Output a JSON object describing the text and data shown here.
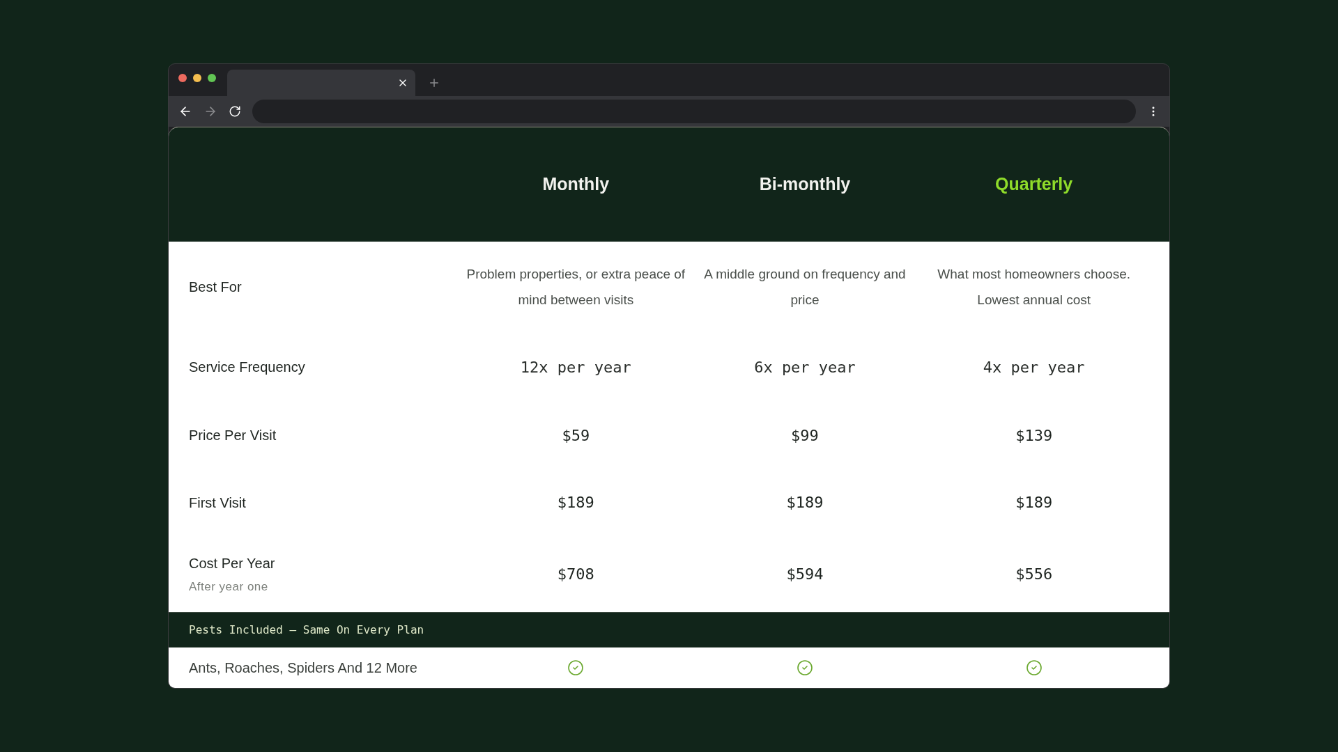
{
  "browser": {
    "forward_disabled": true
  },
  "plans": [
    {
      "name": "Monthly",
      "selected": false
    },
    {
      "name": "Bi-monthly",
      "selected": false
    },
    {
      "name": "Quarterly",
      "selected": true
    }
  ],
  "rows": [
    {
      "label": "Best For",
      "kind": "text",
      "values": [
        "Problem properties, or extra peace of mind between visits",
        "A middle ground on frequency and price",
        "What most homeowners choose. Lowest annual cost"
      ]
    },
    {
      "label": "Service Frequency",
      "kind": "mono",
      "values": [
        "12x per year",
        "6x per year",
        "4x per year"
      ]
    },
    {
      "label": "Price Per Visit",
      "kind": "price",
      "values": [
        "$59",
        "$99",
        "$139"
      ]
    },
    {
      "label": "First Visit",
      "kind": "price",
      "values": [
        "$189",
        "$189",
        "$189"
      ]
    },
    {
      "label": "Cost Per Year",
      "sublabel": "After year one",
      "kind": "price",
      "values": [
        "$708",
        "$594",
        "$556"
      ]
    }
  ],
  "section": {
    "title": "Pests Included — Same On Every Plan"
  },
  "pest_rows": [
    {
      "label": "Ants, Roaches, Spiders And 12 More",
      "included": [
        true,
        true,
        true
      ]
    }
  ]
}
